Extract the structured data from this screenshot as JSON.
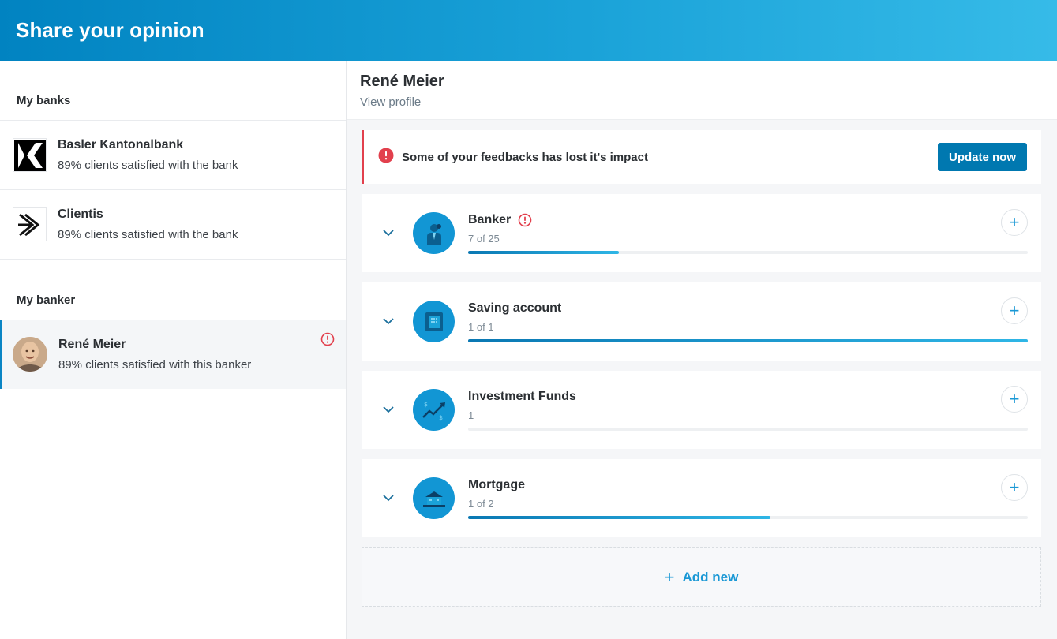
{
  "header": {
    "title": "Share your opinion"
  },
  "sidebar": {
    "banks_title": "My banks",
    "banks": [
      {
        "name": "Basler Kantonalbank",
        "subtitle": "89% clients satisfied with the bank",
        "logo": "bkb-logo"
      },
      {
        "name": "Clientis",
        "subtitle": "89% clients satisfied with the bank",
        "logo": "clientis-logo"
      }
    ],
    "banker_title": "My banker",
    "banker": {
      "name": "René Meier",
      "subtitle": "89% clients satisfied with this banker",
      "alert_icon": "alert-icon"
    }
  },
  "main": {
    "profile": {
      "name": "René Meier",
      "link": "View profile"
    },
    "alert": {
      "message": "Some of your feedbacks has lost it's impact",
      "button": "Update now",
      "color": "#e2404d"
    },
    "categories": [
      {
        "title": "Banker",
        "count": "7 of 25",
        "progress": 0.27,
        "has_alert": true,
        "icon": "banker-icon"
      },
      {
        "title": "Saving account",
        "count": "1 of 1",
        "progress": 1.0,
        "has_alert": false,
        "icon": "safe-icon"
      },
      {
        "title": "Investment Funds",
        "count": "1",
        "progress": 0,
        "has_alert": false,
        "icon": "chart-growth-icon"
      },
      {
        "title": "Mortgage",
        "count": "1 of 2",
        "progress": 0.54,
        "has_alert": false,
        "icon": "house-icon"
      }
    ],
    "add_new": {
      "label": "Add new"
    }
  },
  "colors": {
    "primary": "#0078b0",
    "accent": "#1a98d5",
    "alert": "#e2404d"
  }
}
